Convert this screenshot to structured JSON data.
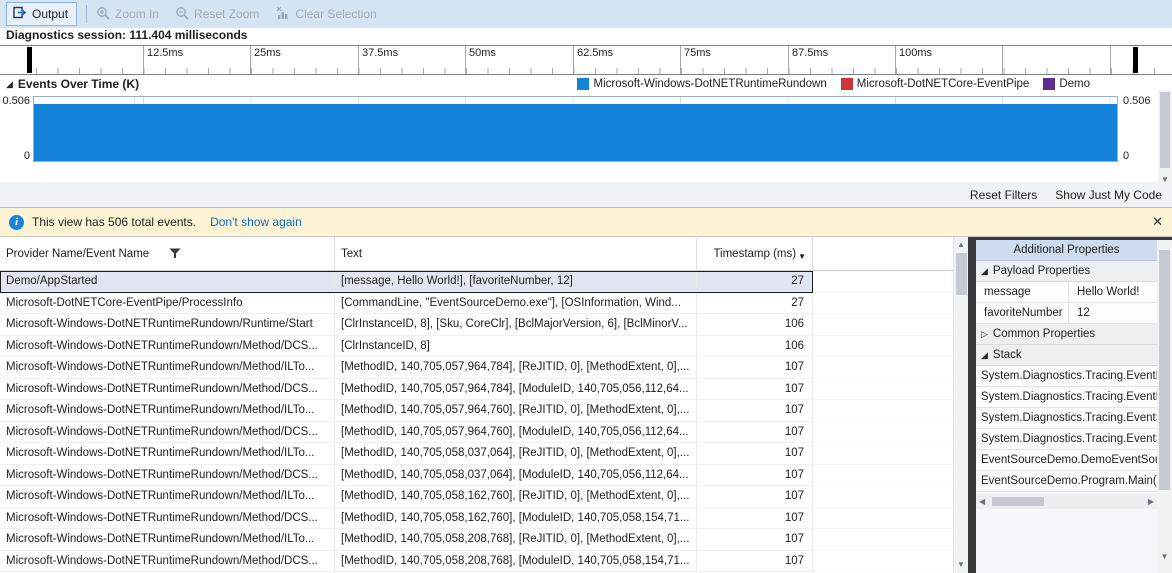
{
  "toolbar": {
    "output_label": "Output",
    "zoom_in_label": "Zoom In",
    "reset_zoom_label": "Reset Zoom",
    "clear_selection_label": "Clear Selection"
  },
  "session": {
    "label": "Diagnostics session: 111.404 milliseconds"
  },
  "ruler": {
    "ticks": [
      "12.5ms",
      "25ms",
      "37.5ms",
      "50ms",
      "62.5ms",
      "75ms",
      "87.5ms",
      "100ms"
    ]
  },
  "chart": {
    "title": "Events Over Time (K)",
    "y_top": "0.506",
    "y_bottom": "0",
    "legend": [
      {
        "label": "Microsoft-Windows-DotNETRuntimeRundown",
        "color": "#1583d9"
      },
      {
        "label": "Microsoft-DotNETCore-EventPipe",
        "color": "#d13438"
      },
      {
        "label": "Demo",
        "color": "#5c2e91"
      }
    ]
  },
  "chart_data": {
    "type": "area",
    "title": "Events Over Time (K)",
    "x_ticks_ms": [
      12.5,
      25,
      37.5,
      50,
      62.5,
      75,
      87.5,
      100
    ],
    "x_range_ms": [
      0,
      111.404
    ],
    "ylim": [
      0,
      0.506
    ],
    "series": [
      {
        "name": "Microsoft-Windows-DotNETRuntimeRundown",
        "color": "#1583d9",
        "values_note": "solid fill at ~0.506K across entire visible 0-111.404ms range"
      },
      {
        "name": "Microsoft-DotNETCore-EventPipe",
        "color": "#d13438",
        "values_note": "not visibly distinguishable"
      },
      {
        "name": "Demo",
        "color": "#5c2e91",
        "values_note": "not visibly distinguishable"
      }
    ],
    "legend_position": "top-right",
    "grid": "faint vertical gridlines at major ticks"
  },
  "filters": {
    "reset_label": "Reset Filters",
    "jmc_label": "Show Just My Code"
  },
  "infobar": {
    "text": "This view has 506 total events.",
    "link": "Don't show again",
    "close": "✕"
  },
  "table": {
    "columns": {
      "provider": "Provider Name/Event Name",
      "text": "Text",
      "timestamp": "Timestamp (ms)"
    },
    "rows": [
      {
        "provider": "Demo/AppStarted",
        "text": "[message, Hello World!], [favoriteNumber, 12]",
        "ts": "27"
      },
      {
        "provider": "Microsoft-DotNETCore-EventPipe/ProcessInfo",
        "text": "[CommandLine, \"EventSourceDemo.exe\"], [OSInformation, Wind...",
        "ts": "27"
      },
      {
        "provider": "Microsoft-Windows-DotNETRuntimeRundown/Runtime/Start",
        "text": "[ClrInstanceID, 8], [Sku, CoreClr], [BclMajorVersion, 6], [BclMinorV...",
        "ts": "106"
      },
      {
        "provider": "Microsoft-Windows-DotNETRuntimeRundown/Method/DCS...",
        "text": "[ClrInstanceID, 8]",
        "ts": "106"
      },
      {
        "provider": "Microsoft-Windows-DotNETRuntimeRundown/Method/ILTo...",
        "text": "[MethodID, 140,705,057,964,784], [ReJITID, 0], [MethodExtent, 0],...",
        "ts": "107"
      },
      {
        "provider": "Microsoft-Windows-DotNETRuntimeRundown/Method/DCS...",
        "text": "[MethodID, 140,705,057,964,784], [ModuleID, 140,705,056,112,64...",
        "ts": "107"
      },
      {
        "provider": "Microsoft-Windows-DotNETRuntimeRundown/Method/ILTo...",
        "text": "[MethodID, 140,705,057,964,760], [ReJITID, 0], [MethodExtent, 0],...",
        "ts": "107"
      },
      {
        "provider": "Microsoft-Windows-DotNETRuntimeRundown/Method/DCS...",
        "text": "[MethodID, 140,705,057,964,760], [ModuleID, 140,705,056,112,64...",
        "ts": "107"
      },
      {
        "provider": "Microsoft-Windows-DotNETRuntimeRundown/Method/ILTo...",
        "text": "[MethodID, 140,705,058,037,064], [ReJITID, 0], [MethodExtent, 0],...",
        "ts": "107"
      },
      {
        "provider": "Microsoft-Windows-DotNETRuntimeRundown/Method/DCS...",
        "text": "[MethodID, 140,705,058,037,064], [ModuleID, 140,705,056,112,64...",
        "ts": "107"
      },
      {
        "provider": "Microsoft-Windows-DotNETRuntimeRundown/Method/ILTo...",
        "text": "[MethodID, 140,705,058,162,760], [ReJITID, 0], [MethodExtent, 0],...",
        "ts": "107"
      },
      {
        "provider": "Microsoft-Windows-DotNETRuntimeRundown/Method/DCS...",
        "text": "[MethodID, 140,705,058,162,760], [ModuleID, 140,705,058,154,71...",
        "ts": "107"
      },
      {
        "provider": "Microsoft-Windows-DotNETRuntimeRundown/Method/ILTo...",
        "text": "[MethodID, 140,705,058,208,768], [ReJITID, 0], [MethodExtent, 0],...",
        "ts": "107"
      },
      {
        "provider": "Microsoft-Windows-DotNETRuntimeRundown/Method/DCS...",
        "text": "[MethodID, 140,705,058,208,768], [ModuleID, 140,705,058,154,71...",
        "ts": "107"
      }
    ]
  },
  "panel": {
    "title": "Additional Properties",
    "payload_header": "Payload Properties",
    "payload": [
      {
        "key": "message",
        "value": "Hello World!"
      },
      {
        "key": "favoriteNumber",
        "value": "12"
      }
    ],
    "common_header": "Common Properties",
    "stack_header": "Stack",
    "frames": [
      "System.Diagnostics.Tracing.EventPip",
      "System.Diagnostics.Tracing.EventPro",
      "System.Diagnostics.Tracing.EventSou",
      "System.Diagnostics.Tracing.EventSou",
      "EventSourceDemo.DemoEventSourc",
      "EventSourceDemo.Program.Main(Sy"
    ]
  }
}
